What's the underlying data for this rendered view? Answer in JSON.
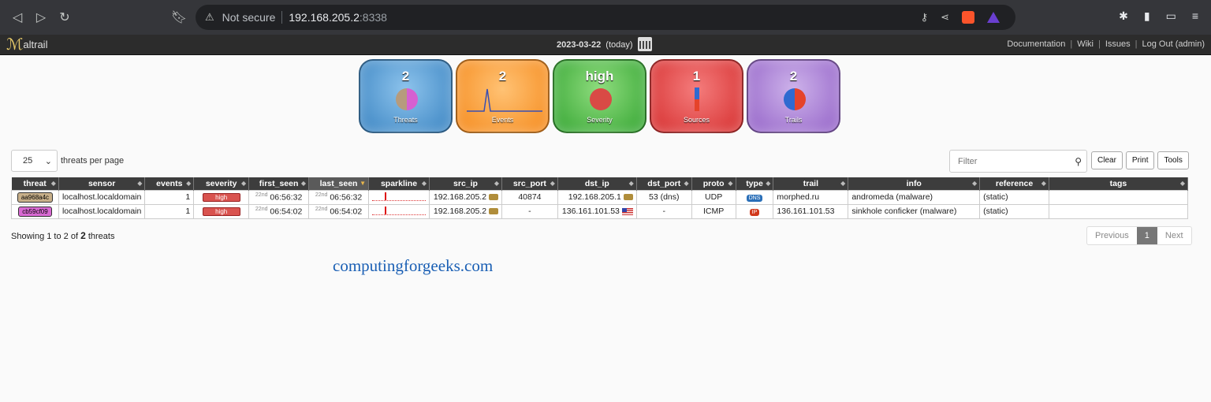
{
  "browser": {
    "security_label": "Not secure",
    "url_host": "192.168.205.2",
    "url_port": ":8338"
  },
  "header": {
    "app_name": "altrail",
    "date": "2023-03-22",
    "date_note": "(today)",
    "links": [
      "Documentation",
      "Wiki",
      "Issues",
      "Log Out (admin)"
    ]
  },
  "stats": [
    {
      "value": "2",
      "label": "Threats"
    },
    {
      "value": "2",
      "label": "Events"
    },
    {
      "value": "high",
      "label": "Severity"
    },
    {
      "value": "1",
      "label": "Sources"
    },
    {
      "value": "2",
      "label": "Trails"
    }
  ],
  "controls": {
    "per_page_value": "25",
    "per_page_label": "threats per page",
    "filter_placeholder": "Filter",
    "buttons": [
      "Clear",
      "Print",
      "Tools"
    ]
  },
  "table": {
    "columns": [
      "threat",
      "sensor",
      "events",
      "severity",
      "first_seen",
      "last_seen",
      "sparkline",
      "src_ip",
      "src_port",
      "dst_ip",
      "dst_port",
      "proto",
      "type",
      "trail",
      "info",
      "reference",
      "tags"
    ],
    "rows": [
      {
        "threat": "aa968a4c",
        "threat_color": "#c8b08a",
        "sensor": "localhost.localdomain",
        "events": "1",
        "severity": "high",
        "first_seen_day": "22",
        "first_seen_ord": "nd",
        "first_seen_time": "06:56:32",
        "last_seen_day": "22",
        "last_seen_ord": "nd",
        "last_seen_time": "06:56:32",
        "src_ip": "192.168.205.2",
        "src_port": "40874",
        "dst_ip": "192.168.205.1",
        "dst_port": "53 (dns)",
        "proto": "UDP",
        "type": "DNS",
        "type_color": "#2a6fb8",
        "trail": "morphed.ru",
        "info": "andromeda (malware)",
        "reference": "(static)",
        "tags": ""
      },
      {
        "threat": "cb59cf09",
        "threat_color": "#d96ad3",
        "sensor": "localhost.localdomain",
        "events": "1",
        "severity": "high",
        "first_seen_day": "22",
        "first_seen_ord": "nd",
        "first_seen_time": "06:54:02",
        "last_seen_day": "22",
        "last_seen_ord": "nd",
        "last_seen_time": "06:54:02",
        "src_ip": "192.168.205.2",
        "src_port": "-",
        "dst_ip": "136.161.101.53",
        "dst_port": "-",
        "proto": "ICMP",
        "type": "IP",
        "type_color": "#d1381b",
        "trail": "136.161.101.53",
        "info": "sinkhole conficker (malware)",
        "reference": "(static)",
        "tags": ""
      }
    ]
  },
  "footer": {
    "showing_prefix": "Showing 1 to 2 of",
    "showing_total": "2",
    "showing_suffix": "threats",
    "pager": [
      "Previous",
      "1",
      "Next"
    ]
  },
  "watermark": "computingforgeeks.com"
}
